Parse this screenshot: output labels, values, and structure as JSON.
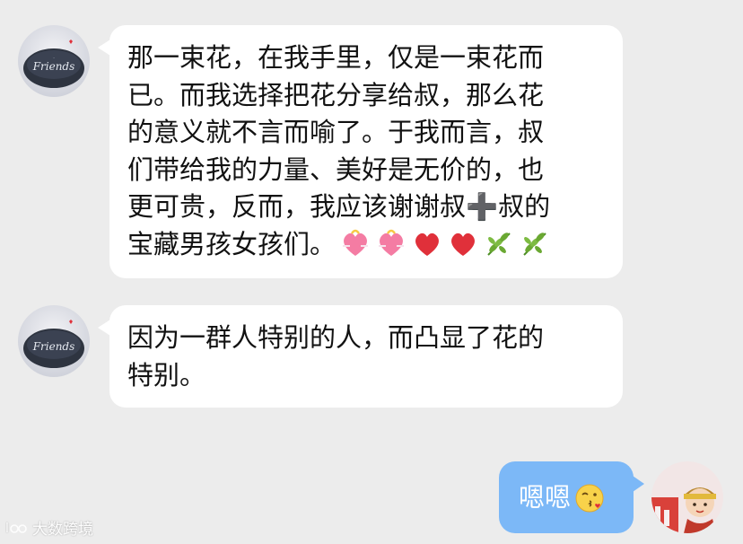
{
  "messages": [
    {
      "sender": "friend",
      "avatar_text": "Friends",
      "lines": [
        "那一束花，在我手里，仅是一束花而",
        "已。而我选择把花分享给叔，那么花",
        "的意义就不言而喻了。于我而言，叔",
        "们带给我的力量、美好是无价的，也",
        "更可贵，反而，我应该谢谢叔➕叔的",
        "宝藏男孩女孩们。"
      ],
      "emojis": [
        "gift-heart-icon",
        "gift-heart-icon",
        "red-heart-icon",
        "red-heart-icon",
        "herb-icon",
        "herb-icon"
      ]
    },
    {
      "sender": "friend",
      "avatar_text": "Friends",
      "lines": [
        "因为一群人特别的人，而凸显了花的",
        "特别。"
      ]
    },
    {
      "sender": "self",
      "text": "嗯嗯",
      "emoji": "blowing-kiss-icon"
    }
  ],
  "watermark": {
    "text": "大数跨境"
  },
  "colors": {
    "background": "#ececec",
    "bubble_friend": "#ffffff",
    "bubble_self": "#7cb8f7",
    "heart": "#e0303a",
    "gift_heart": "#f47ca3",
    "herb": "#6aa832"
  }
}
